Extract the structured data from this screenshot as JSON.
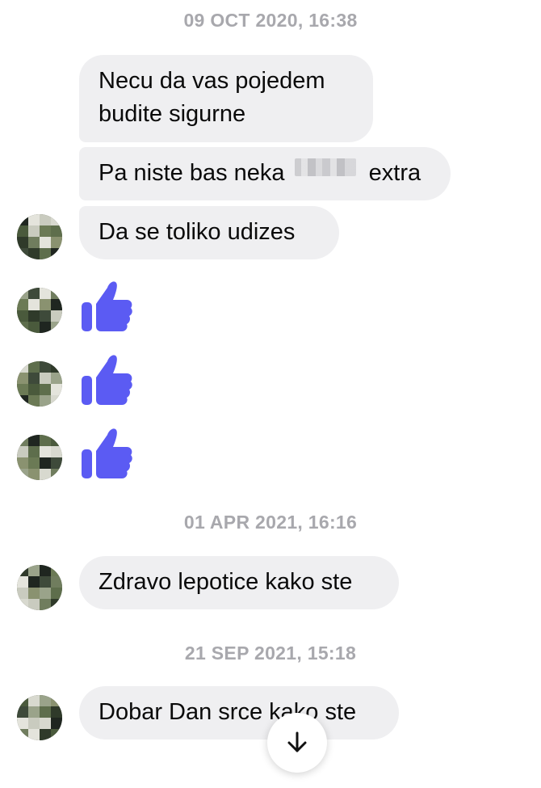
{
  "conversation": {
    "timestamps": [
      "09 OCT 2020, 16:38",
      "01 APR 2021, 16:16",
      "21 SEP 2021, 15:18"
    ],
    "messages": {
      "m1_line1": "Necu da vas pojedem",
      "m1_line2": "budite sigurne",
      "m2_before": "Pa niste bas neka",
      "m2_blurred": "picka",
      "m2_after": "extra",
      "m3": "Da se toliko  udizes",
      "m4": "Zdravo lepotice kako ste",
      "m5": "Dobar Dan srce kako ste"
    },
    "likes_count": 3
  },
  "icons": {
    "like": "thumbs-up-icon",
    "scroll": "arrow-down-icon",
    "avatar": "avatar-pixelated"
  },
  "colors": {
    "bubble": "#efeff1",
    "timestamp": "#a8a8ad",
    "like": "#5b5bf3",
    "text": "#0a0a0a"
  }
}
